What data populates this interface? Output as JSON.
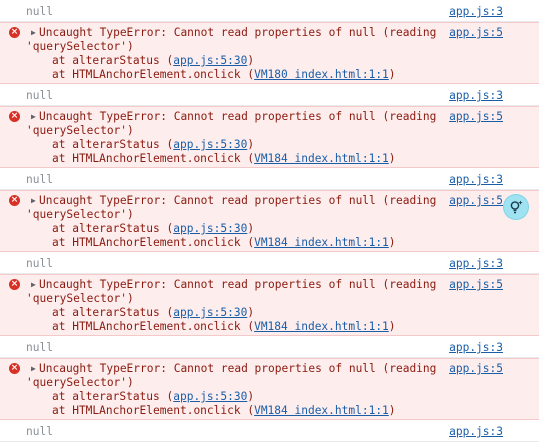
{
  "console": {
    "entries": [
      {
        "null_text": "null",
        "null_source": "app.js:3",
        "error": {
          "message": "Uncaught TypeError: Cannot read properties of null (reading",
          "message_cont": "'querySelector')",
          "source": "app.js:5",
          "stack": [
            {
              "prefix": "at alterarStatus (",
              "link": "app.js:5:30",
              "suffix": ")"
            },
            {
              "prefix": "at HTMLAnchorElement.onclick (",
              "link": "VM180 index.html:1:1",
              "suffix": ")"
            }
          ]
        }
      },
      {
        "null_text": "null",
        "null_source": "app.js:3",
        "error": {
          "message": "Uncaught TypeError: Cannot read properties of null (reading",
          "message_cont": "'querySelector')",
          "source": "app.js:5",
          "stack": [
            {
              "prefix": "at alterarStatus (",
              "link": "app.js:5:30",
              "suffix": ")"
            },
            {
              "prefix": "at HTMLAnchorElement.onclick (",
              "link": "VM184 index.html:1:1",
              "suffix": ")"
            }
          ]
        }
      },
      {
        "null_text": "null",
        "null_source": "app.js:3",
        "error": {
          "message": "Uncaught TypeError: Cannot read properties of null (reading",
          "message_cont": "'querySelector')",
          "source": "app.js:5",
          "stack": [
            {
              "prefix": "at alterarStatus (",
              "link": "app.js:5:30",
              "suffix": ")"
            },
            {
              "prefix": "at HTMLAnchorElement.onclick (",
              "link": "VM184 index.html:1:1",
              "suffix": ")"
            }
          ]
        }
      },
      {
        "null_text": "null",
        "null_source": "app.js:3",
        "error": {
          "message": "Uncaught TypeError: Cannot read properties of null (reading",
          "message_cont": "'querySelector')",
          "source": "app.js:5",
          "stack": [
            {
              "prefix": "at alterarStatus (",
              "link": "app.js:5:30",
              "suffix": ")"
            },
            {
              "prefix": "at HTMLAnchorElement.onclick (",
              "link": "VM184 index.html:1:1",
              "suffix": ")"
            }
          ]
        }
      },
      {
        "null_text": "null",
        "null_source": "app.js:3",
        "error": {
          "message": "Uncaught TypeError: Cannot read properties of null (reading",
          "message_cont": "'querySelector')",
          "source": "app.js:5",
          "stack": [
            {
              "prefix": "at alterarStatus (",
              "link": "app.js:5:30",
              "suffix": ")"
            },
            {
              "prefix": "at HTMLAnchorElement.onclick (",
              "link": "VM184 index.html:1:1",
              "suffix": ")"
            }
          ]
        }
      }
    ],
    "trailing": {
      "null_text": "null",
      "null_source": "app.js:3"
    }
  },
  "hint_button": {
    "icon": "lightbulb-sparkle-icon"
  },
  "colors": {
    "error_background": "#fdeded",
    "error_text": "#8b1a10",
    "link": "#1a5ea8",
    "error_icon": "#d93025",
    "hint_button": "#9fe3f2"
  }
}
